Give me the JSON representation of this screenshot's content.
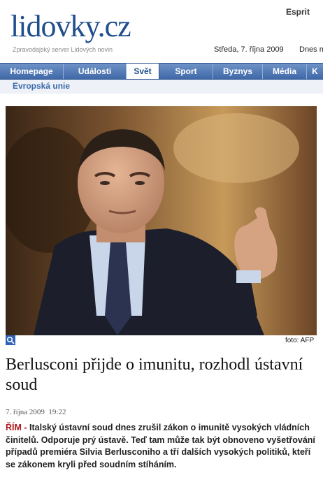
{
  "header": {
    "logo": "lidovky.cz",
    "tagline": "Zpravodajský server Lidových novin",
    "top_link": "Esprit",
    "date": "Středa, 7. října 2009",
    "date_extra": "Dnes m"
  },
  "nav": {
    "items": [
      {
        "label": "Homepage"
      },
      {
        "label": "Události"
      },
      {
        "label": "Svět"
      },
      {
        "label": "Sport"
      },
      {
        "label": "Byznys"
      },
      {
        "label": "Média"
      },
      {
        "label": "K"
      }
    ],
    "active": "Svět"
  },
  "subnav": {
    "label": "Evropská unie"
  },
  "photo": {
    "credit": "foto: AFP"
  },
  "article": {
    "headline": "Berlusconi přijde o imunitu, rozhodl ústavní soud",
    "date": "7. října 2009",
    "time": "19:22",
    "location": "ŘÍM -",
    "perex": "Italský ústavní soud dnes zrušil zákon o imunitě vysokých vládních činitelů. Odporuje prý ústavě. Teď tam může tak být obnoveno vyšetřování případů premiéra Silvia Berlusconiho a tří dalších vysokých politiků, kteří se zákonem kryli před soudním stíháním."
  },
  "colors": {
    "brand": "#1f4e8c",
    "nav_bg": "#4f78b8",
    "location_red": "#b0171f"
  }
}
